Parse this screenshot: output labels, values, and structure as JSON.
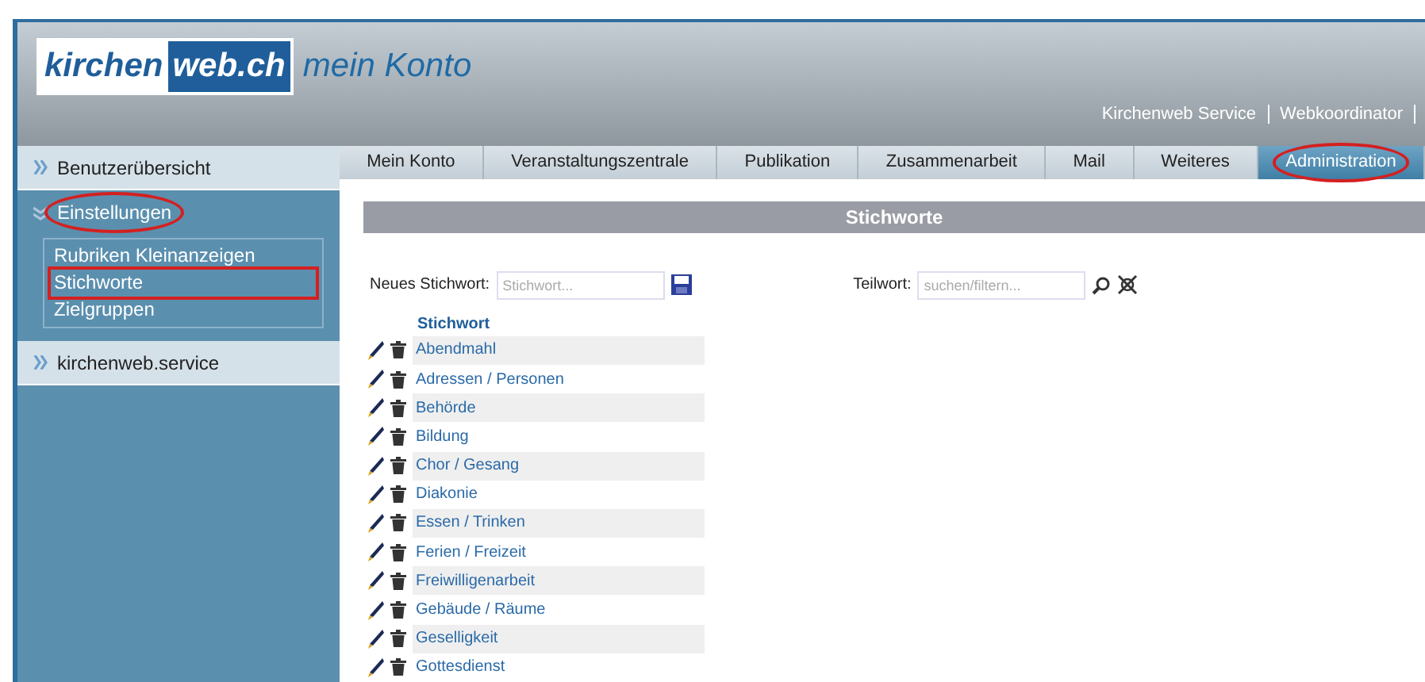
{
  "header": {
    "logo_left": "kirchen",
    "logo_right": "web.ch",
    "title": "mein Konto",
    "links": [
      "Kirchenweb Service",
      "Webkoordinator"
    ]
  },
  "sidebar": [
    {
      "label": "Benutzerübersicht",
      "expanded": false,
      "annotated": false
    },
    {
      "label": "Einstellungen",
      "expanded": true,
      "annotated": true,
      "children": [
        {
          "label": "Rubriken Kleinanzeigen",
          "annotated": false
        },
        {
          "label": "Stichworte",
          "annotated": true
        },
        {
          "label": "Zielgruppen",
          "annotated": false
        }
      ]
    },
    {
      "label": "kirchenweb.service",
      "expanded": false,
      "annotated": false
    }
  ],
  "tabs": [
    {
      "label": "Mein Konto",
      "selected": false,
      "annotated": false
    },
    {
      "label": "Veranstaltungszentrale",
      "selected": false,
      "annotated": false
    },
    {
      "label": "Publikation",
      "selected": false,
      "annotated": false
    },
    {
      "label": "Zusammenarbeit",
      "selected": false,
      "annotated": false
    },
    {
      "label": "Mail",
      "selected": false,
      "annotated": false
    },
    {
      "label": "Weiteres",
      "selected": false,
      "annotated": false
    },
    {
      "label": "Administration",
      "selected": true,
      "annotated": true
    }
  ],
  "panel": {
    "title": "Stichworte",
    "new_label": "Neues Stichwort:",
    "new_placeholder": "Stichwort...",
    "filter_label": "Teilwort:",
    "filter_placeholder": "suchen/filtern...",
    "column": "Stichwort",
    "rows": [
      "Abendmahl",
      "Adressen / Personen",
      "Behörde",
      "Bildung",
      "Chor / Gesang",
      "Diakonie",
      "Essen / Trinken",
      "Ferien / Freizeit",
      "Freiwilligenarbeit",
      "Gebäude / Räume",
      "Geselligkeit",
      "Gottesdienst"
    ]
  }
}
